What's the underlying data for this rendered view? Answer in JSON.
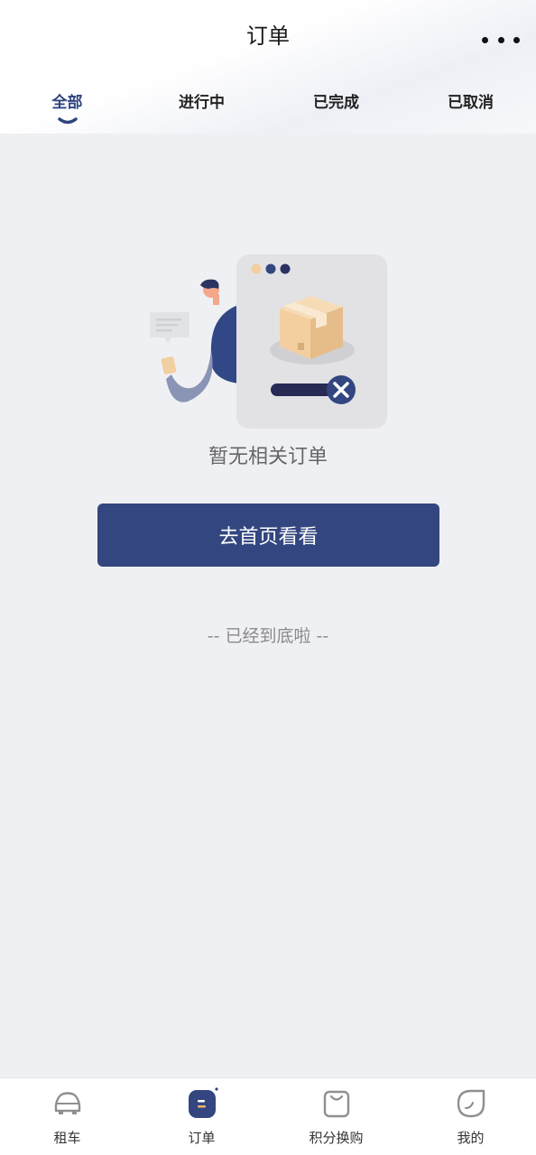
{
  "header": {
    "title": "订单"
  },
  "tabs": [
    {
      "label": "全部",
      "active": true
    },
    {
      "label": "进行中",
      "active": false
    },
    {
      "label": "已完成",
      "active": false
    },
    {
      "label": "已取消",
      "active": false
    }
  ],
  "empty_state": {
    "message": "暂无相关订单",
    "button_label": "去首页看看"
  },
  "bottom_note": "-- 已经到底啦 --",
  "tabbar": [
    {
      "label": "租车",
      "icon": "car-icon",
      "active": false
    },
    {
      "label": "订单",
      "icon": "order-icon",
      "active": true
    },
    {
      "label": "积分换购",
      "icon": "shopping-bag-icon",
      "active": false
    },
    {
      "label": "我的",
      "icon": "profile-icon",
      "active": false
    }
  ],
  "colors": {
    "accent": "#334680",
    "background": "#eff0f3",
    "active_tab": "#2f4481"
  }
}
